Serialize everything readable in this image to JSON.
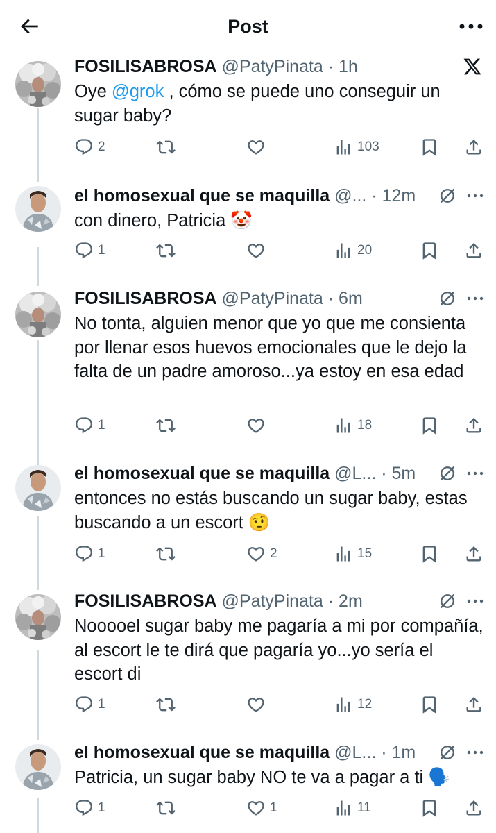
{
  "header": {
    "title": "Post"
  },
  "tweets": [
    {
      "name": "FOSILISABROSA",
      "handle": "@PatyPinata",
      "time": "1h",
      "text_pre": "Oye ",
      "mention": "@grok",
      "text_post": " , cómo se puede uno conseguir un sugar baby?",
      "replies": "2",
      "reposts": "",
      "likes": "",
      "views": "103"
    },
    {
      "name": "el homosexual que se maquilla",
      "handle": "@...",
      "time": "12m",
      "text": "con dinero, Patricia 🤡",
      "replies": "1",
      "reposts": "",
      "likes": "",
      "views": "20"
    },
    {
      "name": "FOSILISABROSA",
      "handle": "@PatyPinata",
      "time": "6m",
      "text": "No tonta, alguien menor que yo que me consienta por llenar esos huevos emocionales que le dejo la falta de un padre amoroso...ya estoy en esa edad",
      "replies": "1",
      "reposts": "",
      "likes": "",
      "views": "18"
    },
    {
      "name": "el homosexual que se maquilla",
      "handle": "@L...",
      "time": "5m",
      "text": "entonces no estás buscando un sugar baby, estas buscando a un escort 🤨",
      "replies": "1",
      "reposts": "",
      "likes": "2",
      "views": "15"
    },
    {
      "name": "FOSILISABROSA",
      "handle": "@PatyPinata",
      "time": "2m",
      "text": "Nooooel sugar baby me pagaría a mi por compañía, al escort le te dirá que pagaría yo...yo sería el escort di",
      "replies": "1",
      "reposts": "",
      "likes": "",
      "views": "12"
    },
    {
      "name": "el homosexual que se maquilla",
      "handle": "@L...",
      "time": "1m",
      "text": "Patricia, un sugar baby NO te va a pagar a ti 🗣️",
      "replies": "1",
      "reposts": "",
      "likes": "1",
      "views": "11"
    }
  ],
  "icons": {
    "back": "arrow-left-icon",
    "more": "more-horizontal-icon",
    "x_logo": "x-logo-icon",
    "grok": "grok-icon",
    "reply": "reply-icon",
    "repost": "repost-icon",
    "like": "heart-icon",
    "views": "views-icon",
    "bookmark": "bookmark-icon",
    "share": "share-icon"
  },
  "colors": {
    "accent": "#1d9bf0",
    "text": "#0f1419",
    "secondary": "#536471",
    "line": "#cfd9de"
  }
}
